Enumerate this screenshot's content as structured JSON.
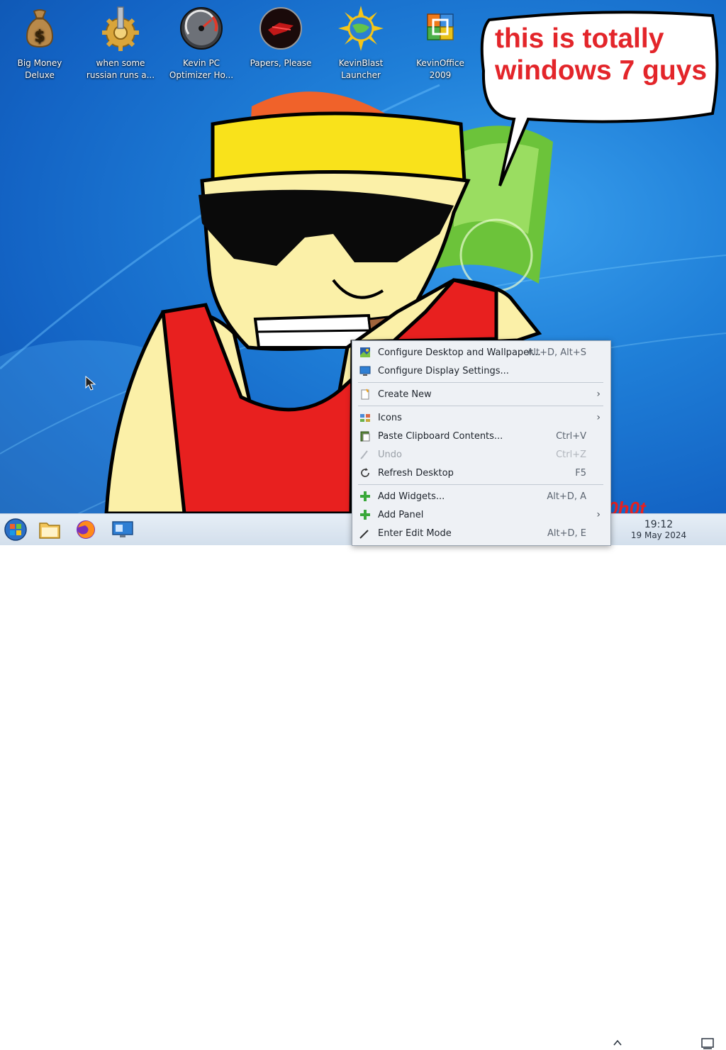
{
  "desktop_icons": [
    {
      "label": "Big Money\nDeluxe",
      "icon": "money-bag-icon"
    },
    {
      "label": "when some\nrussian runs a...",
      "icon": "gear-icon"
    },
    {
      "label": "Kevin PC\nOptimizer Ho...",
      "icon": "speedometer-icon"
    },
    {
      "label": "Papers, Please",
      "icon": "papers-please-icon"
    },
    {
      "label": "KevinBlast\nLauncher",
      "icon": "sun-globe-icon"
    },
    {
      "label": "KevinOffice\n2009",
      "icon": "office-icon"
    }
  ],
  "speech_bubble": {
    "text": "this is totally\nwindows 7 guys"
  },
  "context_menu": {
    "items": [
      {
        "label": "Configure Desktop and Wallpaper...",
        "shortcut": "Alt+D, Alt+S",
        "icon": "wallpaper-icon"
      },
      {
        "label": "Configure Display Settings...",
        "shortcut": "",
        "icon": "display-icon"
      },
      {
        "label": "Create New",
        "shortcut": "",
        "icon": "new-file-icon",
        "submenu": true
      },
      {
        "label": "Icons",
        "shortcut": "",
        "icon": "icons-grid-icon",
        "submenu": true
      },
      {
        "label": "Paste Clipboard Contents...",
        "shortcut": "Ctrl+V",
        "icon": "paste-icon"
      },
      {
        "label": "Undo",
        "shortcut": "Ctrl+Z",
        "icon": "undo-icon",
        "disabled": true
      },
      {
        "label": "Refresh Desktop",
        "shortcut": "F5",
        "icon": "refresh-icon"
      },
      {
        "label": "Add Widgets...",
        "shortcut": "Alt+D, A",
        "icon": "add-icon"
      },
      {
        "label": "Add Panel",
        "shortcut": "",
        "icon": "add-icon",
        "submenu": true
      },
      {
        "label": "Enter Edit Mode",
        "shortcut": "Alt+D, E",
        "icon": "edit-mode-icon"
      }
    ]
  },
  "taskbar": {
    "clock_time": "19:12",
    "clock_date": "19 May 2024",
    "launchers": [
      "start-orb-icon",
      "file-manager-icon",
      "firefox-icon",
      "system-settings-icon"
    ]
  },
  "colors": {
    "bubble_text": "#e3252a",
    "desktop_bg": "#1f7fd8",
    "taskbar_bg": "#dce6f1",
    "menu_bg": "#eef1f5"
  }
}
